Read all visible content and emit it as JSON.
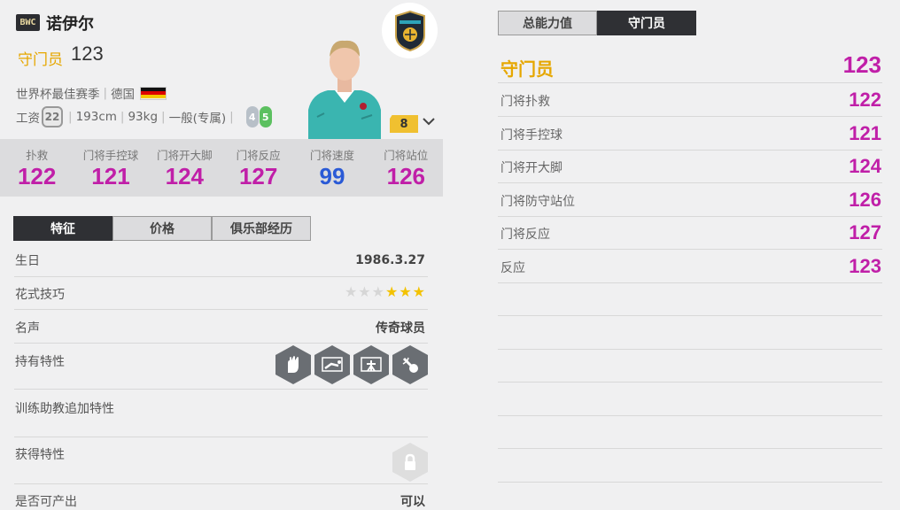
{
  "player": {
    "season_badge": "BWC",
    "name": "诺伊尔",
    "position": "守门员",
    "position_ovr": "123",
    "season_name": "世界杯最佳赛季",
    "nation": "德国",
    "wage_label": "工资",
    "wage": "22",
    "height": "193cm",
    "weight": "93kg",
    "body_type": "一般(专属)",
    "weak_foot": "4",
    "strong_foot": "5",
    "enhance_level": "8"
  },
  "stats": [
    {
      "label": "扑救",
      "value": "122",
      "color": "#c01fa8"
    },
    {
      "label": "门将手控球",
      "value": "121",
      "color": "#c01fa8"
    },
    {
      "label": "门将开大脚",
      "value": "124",
      "color": "#c01fa8"
    },
    {
      "label": "门将反应",
      "value": "127",
      "color": "#c01fa8"
    },
    {
      "label": "门将速度",
      "value": "99",
      "color": "#2a5ad6"
    },
    {
      "label": "门将站位",
      "value": "126",
      "color": "#c01fa8"
    }
  ],
  "tabs_left": [
    "特征",
    "价格",
    "俱乐部经历"
  ],
  "details": {
    "birthday_label": "生日",
    "birthday": "1986.3.27",
    "skill_moves_label": "花式技巧",
    "skill_moves": 3,
    "skill_moves_max": 6,
    "reputation_label": "名声",
    "reputation": "传奇球员",
    "traits_label": "持有特性",
    "trait_icons": [
      "gloves-icon",
      "keeper-dive-icon",
      "goal-net-icon",
      "punch-icon"
    ],
    "coach_traits_label": "训练助教追加特性",
    "acquired_traits_label": "获得特性",
    "producible_label": "是否可产出",
    "producible": "可以"
  },
  "tabs_right": [
    "总能力值",
    "守门员"
  ],
  "position_ratings": {
    "header_label": "守门员",
    "header_value": "123",
    "rows": [
      {
        "label": "门将扑救",
        "value": "122"
      },
      {
        "label": "门将手控球",
        "value": "121"
      },
      {
        "label": "门将开大脚",
        "value": "124"
      },
      {
        "label": "门将防守站位",
        "value": "126"
      },
      {
        "label": "门将反应",
        "value": "127"
      },
      {
        "label": "反应",
        "value": "123"
      }
    ]
  },
  "colors": {
    "accent": "#e6a700",
    "stat_magenta": "#c01fa8",
    "stat_blue": "#2a5ad6",
    "tab_active": "#2f3034"
  }
}
